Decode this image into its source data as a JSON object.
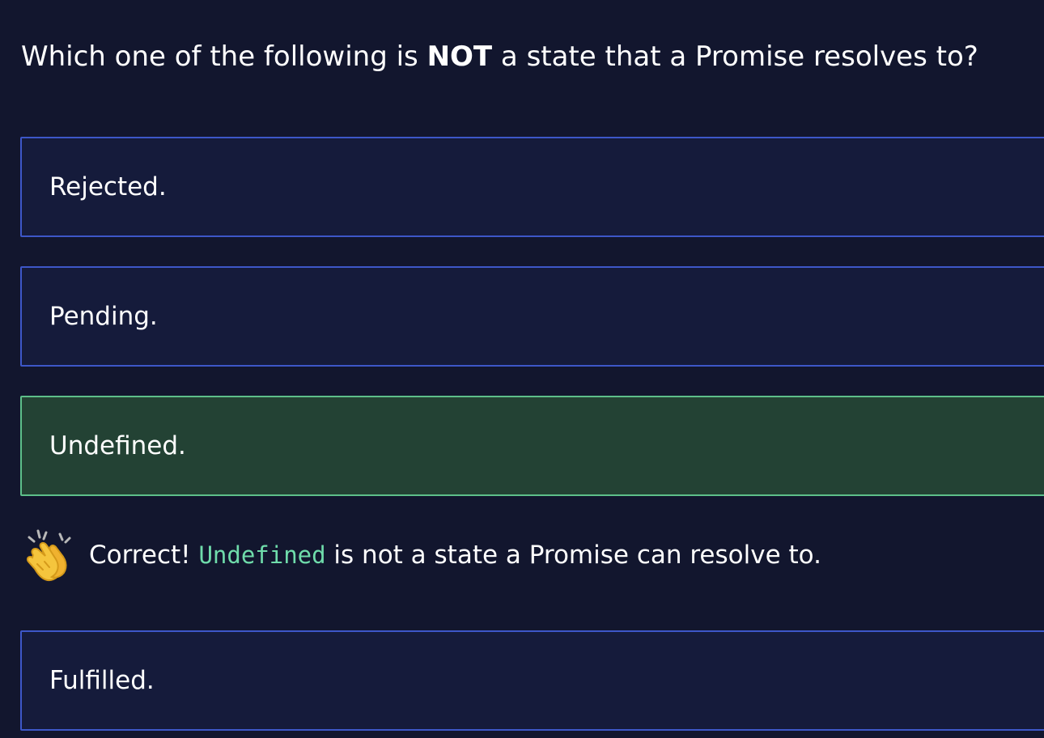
{
  "question": {
    "prefix": "Which one of the following is ",
    "emphasis": "NOT",
    "suffix": " a state that a Promise resolves to?"
  },
  "options": [
    {
      "label": "Rejected.",
      "state": "default"
    },
    {
      "label": "Pending.",
      "state": "default"
    },
    {
      "label": "Undefined.",
      "state": "correct"
    },
    {
      "label": "Fulfilled.",
      "state": "default"
    }
  ],
  "feedback": {
    "icon": "clapping-hands-icon",
    "prefix": "Correct! ",
    "code": "Undefined",
    "suffix": " is not a state a Promise can resolve to."
  },
  "colors": {
    "background": "#12162e",
    "option_background": "#151b3b",
    "option_border": "#3d57c8",
    "correct_background": "#234234",
    "correct_border": "#5dbf8a",
    "code_text": "#6fdcab"
  }
}
